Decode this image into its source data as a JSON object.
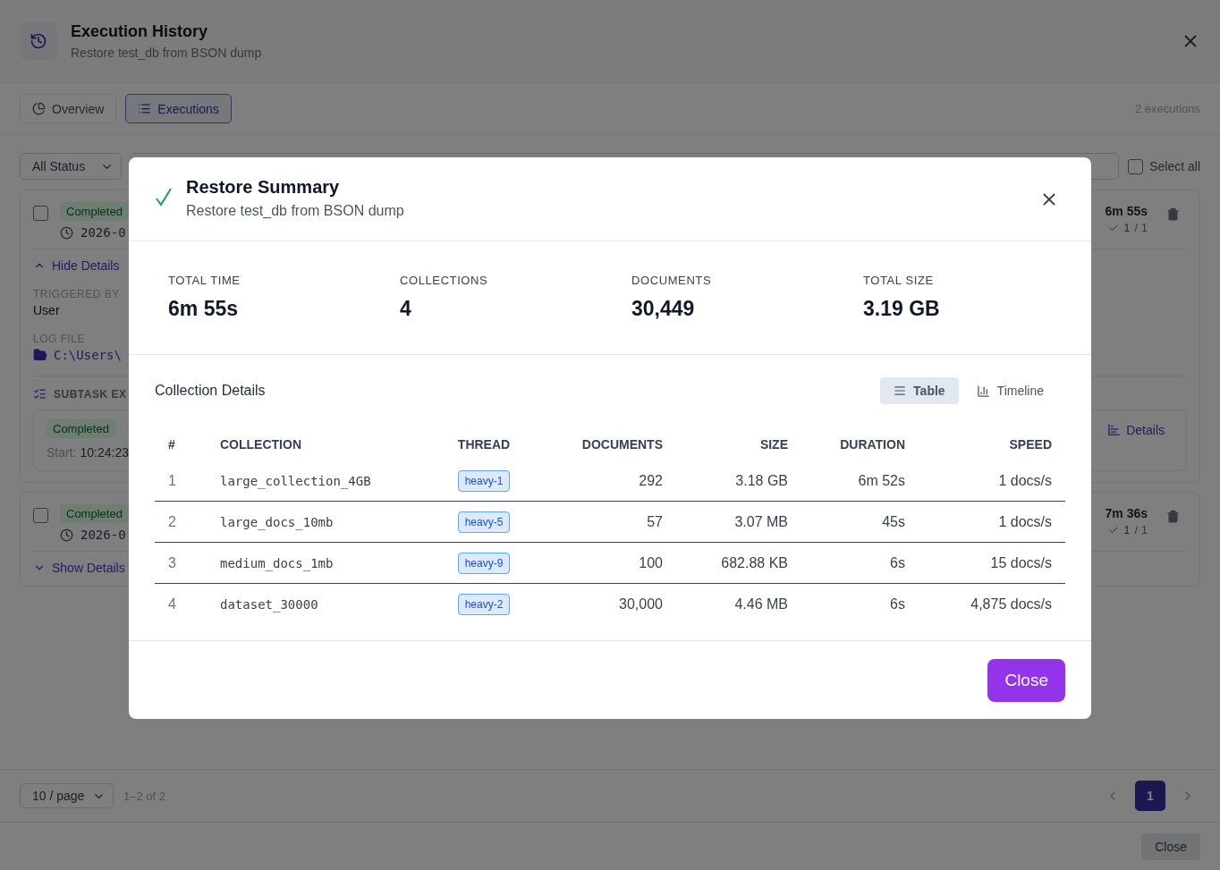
{
  "window": {
    "title": "Execution History",
    "subtitle": "Restore test_db from BSON dump"
  },
  "tabs": [
    {
      "label": "Overview",
      "selected": false
    },
    {
      "label": "Executions",
      "selected": true
    }
  ],
  "count": "2 executions",
  "filters": {
    "status": "All Status",
    "select_all": {
      "label": "Select all",
      "checked": false
    }
  },
  "executions": [
    {
      "checked": false,
      "status": "Completed",
      "started": "2026-0",
      "duration": "6m 55s",
      "succeeded": "1",
      "total": "/ 1",
      "expanded": true,
      "toggle": "Hide Details",
      "fields": [
        {
          "label": "TRIGGERED BY",
          "value": "User",
          "kind": "text"
        },
        {
          "label": "LOG FILE",
          "value": "C:\\Users\\",
          "kind": "path"
        }
      ],
      "subtasks_title": "SUBTASK EX",
      "subtasks": [
        {
          "status": "Completed",
          "start_label": "Start:",
          "start": "10:24:23",
          "action": "Details"
        }
      ]
    },
    {
      "checked": false,
      "status": "Completed",
      "started": "2026-0",
      "duration": "7m 36s",
      "succeeded": "1",
      "total": "/ 1",
      "expanded": false,
      "toggle": "Show Details"
    }
  ],
  "pagination": {
    "page_size": "10 / page",
    "range": "1–2 of 2",
    "pages": [
      {
        "label": "1",
        "selected": true
      }
    ]
  },
  "footer_button": "Close",
  "modal": {
    "title": "Restore Summary",
    "subtitle": "Restore test_db from BSON dump",
    "stats": [
      {
        "label": "TOTAL TIME",
        "value": "6m 55s"
      },
      {
        "label": "COLLECTIONS",
        "value": "4"
      },
      {
        "label": "DOCUMENTS",
        "value": "30,449"
      },
      {
        "label": "TOTAL SIZE",
        "value": "3.19 GB"
      }
    ],
    "section_title": "Collection Details",
    "views": [
      {
        "label": "Table",
        "selected": true
      },
      {
        "label": "Timeline",
        "selected": false
      }
    ],
    "table": {
      "columns": [
        {
          "label": "#",
          "kind": "index"
        },
        {
          "label": "COLLECTION",
          "kind": "name"
        },
        {
          "label": "THREAD",
          "kind": "tag"
        },
        {
          "label": "DOCUMENTS",
          "kind": "number"
        },
        {
          "label": "SIZE",
          "kind": "number"
        },
        {
          "label": "DURATION",
          "kind": "number"
        },
        {
          "label": "SPEED",
          "kind": "number"
        }
      ],
      "rows": [
        [
          "1",
          "large_collection_4GB",
          "heavy-1",
          "292",
          "3.18 GB",
          "6m 52s",
          "1 docs/s"
        ],
        [
          "2",
          "large_docs_10mb",
          "heavy-5",
          "57",
          "3.07 MB",
          "45s",
          "1 docs/s"
        ],
        [
          "3",
          "medium_docs_1mb",
          "heavy-9",
          "100",
          "682.88 KB",
          "6s",
          "15 docs/s"
        ],
        [
          "4",
          "dataset_30000",
          "heavy-2",
          "30,000",
          "4.46 MB",
          "6s",
          "4,875 docs/s"
        ]
      ]
    },
    "close": "Close"
  }
}
